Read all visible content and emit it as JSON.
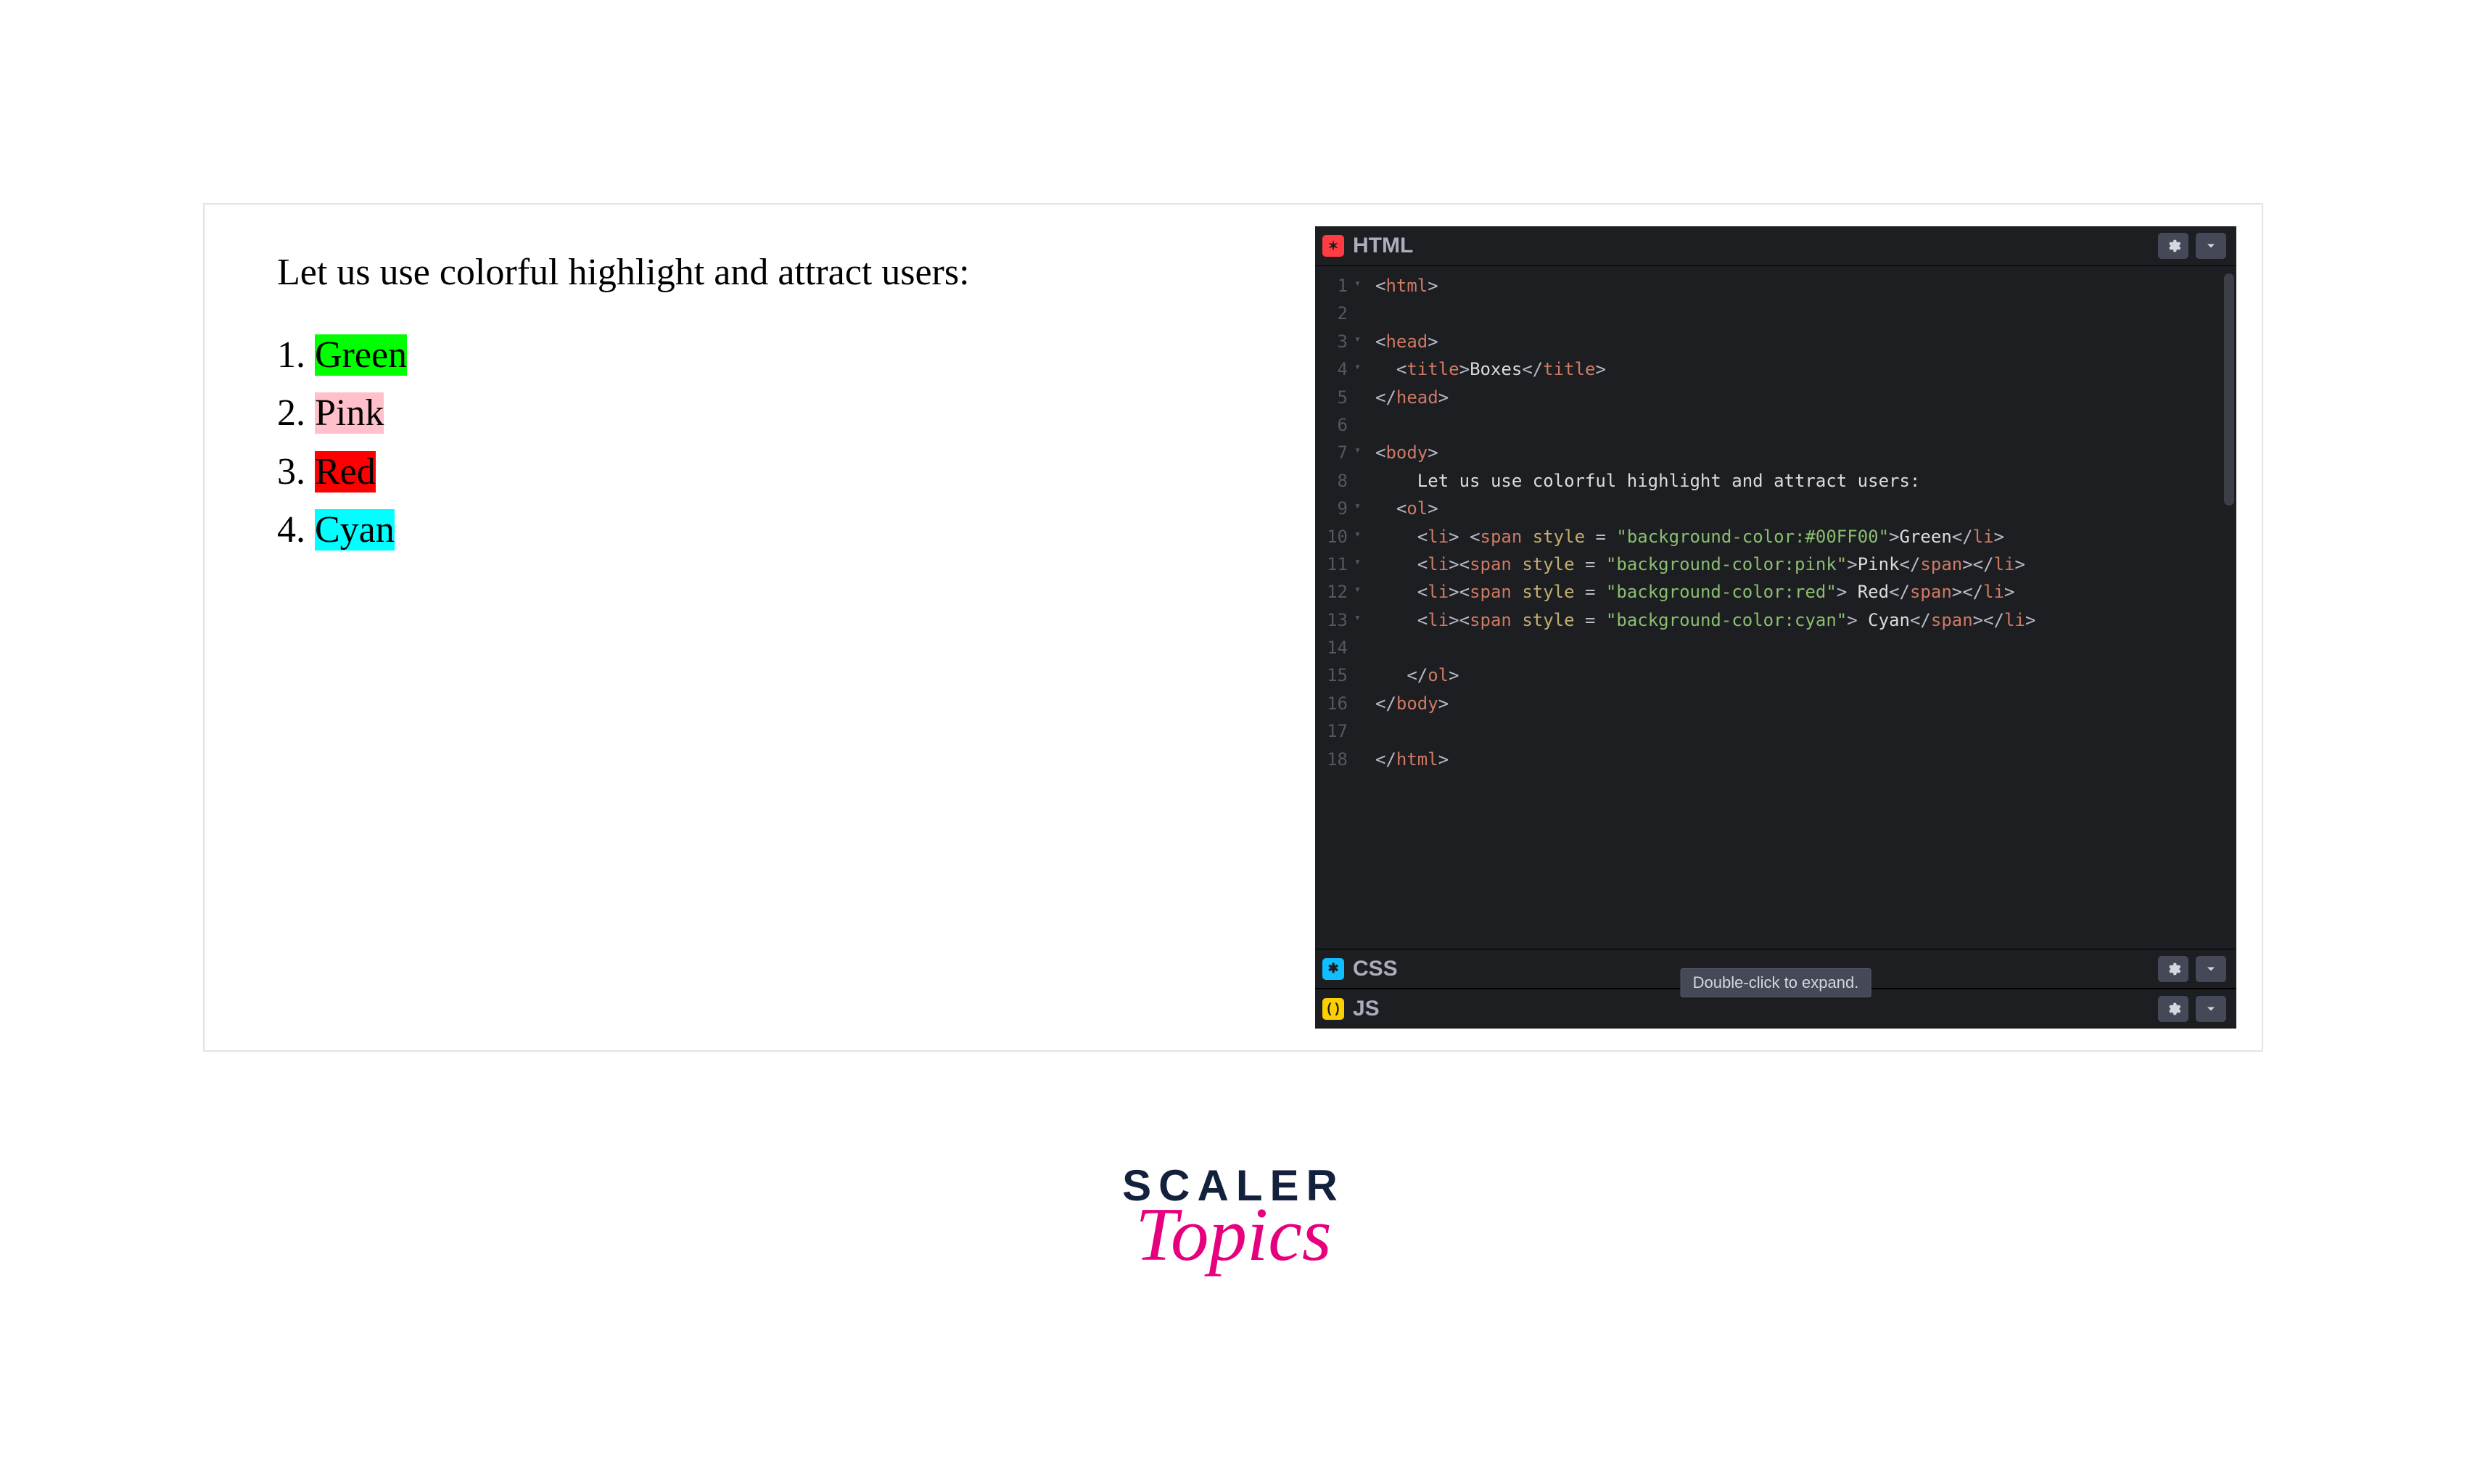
{
  "preview": {
    "intro": "Let us use colorful highlight and attract users:",
    "items": [
      "Green",
      "Pink",
      "Red",
      "Cyan"
    ]
  },
  "editor": {
    "panels": {
      "html": "HTML",
      "css": "CSS",
      "js": "JS"
    },
    "tooltip": "Double-click to expand.",
    "line_numbers": [
      "1",
      "2",
      "3",
      "4",
      "5",
      "6",
      "7",
      "8",
      "9",
      "10",
      "11",
      "12",
      "13",
      "14",
      "15",
      "16",
      "17",
      "18"
    ],
    "code": {
      "l1": {
        "open": "<",
        "tag": "html",
        "close": ">"
      },
      "l3": {
        "open": "<",
        "tag": "head",
        "close": ">"
      },
      "l4": {
        "o1": "<",
        "tag": "title",
        "c1": ">",
        "txt": "Boxes",
        "o2": "</",
        "c2": ">"
      },
      "l5": {
        "open": "</",
        "tag": "head",
        "close": ">"
      },
      "l7": {
        "open": "<",
        "tag": "body",
        "close": ">"
      },
      "l8": {
        "txt": "Let us use colorful highlight and attract users:"
      },
      "l9": {
        "open": "<",
        "tag": "ol",
        "close": ">"
      },
      "l10": {
        "li_o": "<",
        "li": "li",
        "li_c": "> ",
        "sp_o": "<",
        "span": "span",
        "sp": " ",
        "attr": "style",
        "eq": " = ",
        "str": "\"background-color:#00FF00\"",
        "gt": ">",
        "txt": "Green",
        "cli_o": "</",
        "cli_c": ">"
      },
      "l11": {
        "li_o": "<",
        "li": "li",
        "li_c": ">",
        "sp_o": "<",
        "span": "span",
        "sp": " ",
        "attr": "style",
        "eq": " = ",
        "str": "\"background-color:pink\"",
        "gt": ">",
        "txt": "Pink",
        "csp_o": "</",
        "csp_c": ">",
        "cli_o": "</",
        "cli_c": ">"
      },
      "l12": {
        "li_o": "<",
        "li": "li",
        "li_c": ">",
        "sp_o": "<",
        "span": "span",
        "sp": " ",
        "attr": "style",
        "eq": " = ",
        "str": "\"background-color:red\"",
        "gt": ">",
        "txt": " Red",
        "csp_o": "</",
        "csp_c": ">",
        "cli_o": "</",
        "cli_c": ">"
      },
      "l13": {
        "li_o": "<",
        "li": "li",
        "li_c": ">",
        "sp_o": "<",
        "span": "span",
        "sp": " ",
        "attr": "style",
        "eq": " = ",
        "str": "\"background-color:cyan\"",
        "gt": ">",
        "txt": " Cyan",
        "csp_o": "</",
        "csp_c": ">",
        "cli_o": "</",
        "cli_c": ">"
      },
      "l15": {
        "open": "</",
        "tag": "ol",
        "close": ">"
      },
      "l16": {
        "open": "</",
        "tag": "body",
        "close": ">"
      },
      "l18": {
        "open": "</",
        "tag": "html",
        "close": ">"
      }
    }
  },
  "logo": {
    "line1": "SCALER",
    "line2": "Topics"
  }
}
